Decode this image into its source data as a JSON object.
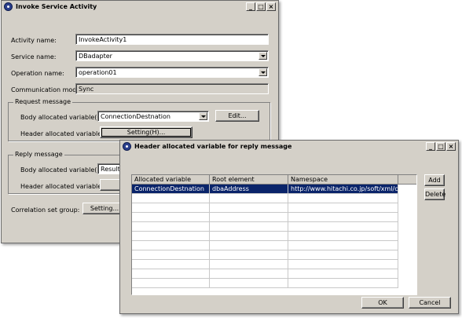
{
  "main_window": {
    "title": "Invoke Service Activity",
    "activity_name_label": "Activity name:",
    "activity_name_value": "InvokeActivity1",
    "service_name_label": "Service name:",
    "service_name_value": "DBadapter",
    "operation_name_label": "Operation name:",
    "operation_name_value": "operation01",
    "communication_model_label": "Communication model:",
    "communication_model_value": "Sync",
    "request_group": {
      "title": "Request message",
      "body_label": "Body allocated variable(Q):",
      "body_value": "ConnectionDestnation",
      "edit_button": "Edit...",
      "header_label": "Header allocated variable:",
      "setting_button": "Setting(H)..."
    },
    "reply_group": {
      "title": "Reply message",
      "body_label": "Body allocated variable(R):",
      "body_value": "ResultO",
      "header_label": "Header allocated variable:"
    },
    "correlation_label": "Correlation set group:",
    "correlation_button": "Setting..."
  },
  "dialog": {
    "title": "Header allocated variable for reply message",
    "columns": [
      "Allocated variable",
      "Root element",
      "Namespace"
    ],
    "rows": [
      {
        "allocated_variable": "ConnectionDestnation",
        "root_element": "dbaAddress",
        "namespace": "http://www.hitachi.co.jp/soft/xml/cos..."
      }
    ],
    "add_button": "Add",
    "delete_button": "Delete",
    "ok_button": "OK",
    "cancel_button": "Cancel"
  },
  "icons": {
    "app": "app-icon",
    "minimize": "minimize-icon",
    "maximize": "maximize-icon",
    "close": "close-icon",
    "dropdown": "chevron-down-icon"
  },
  "colors": {
    "face": "#d4d0c8",
    "selection": "#0a246a"
  }
}
